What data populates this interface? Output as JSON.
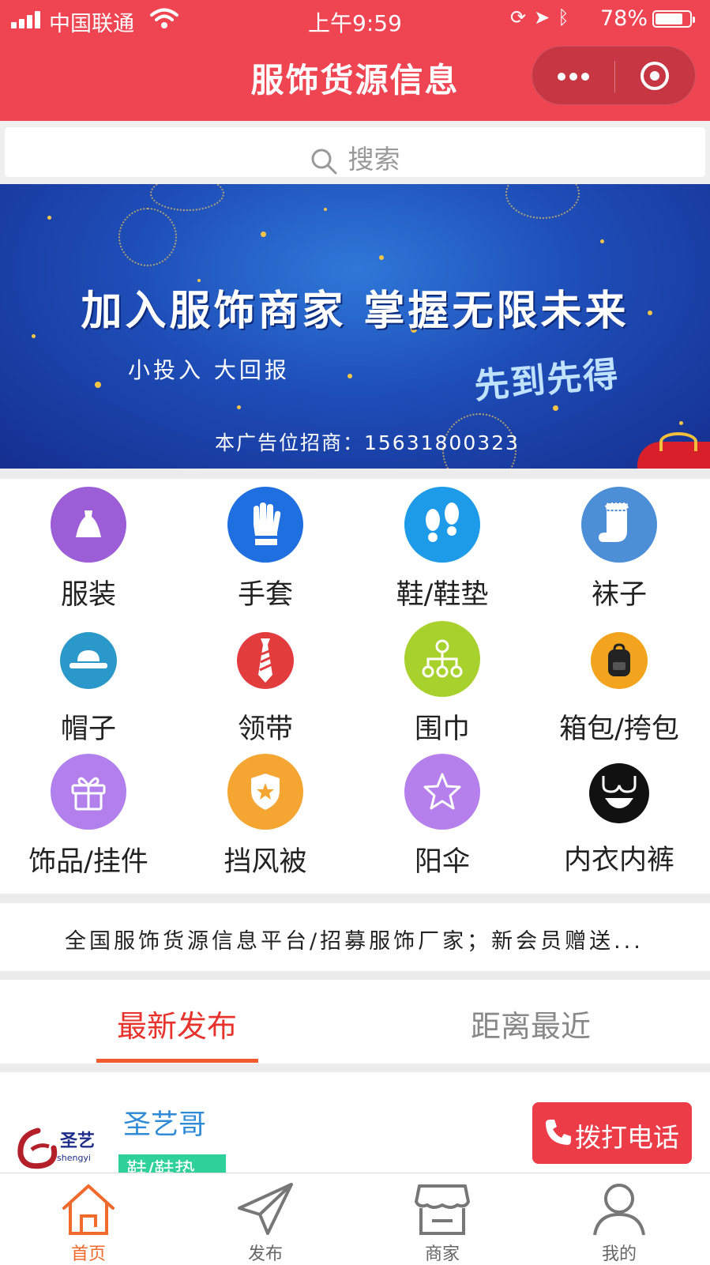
{
  "status_bar": {
    "carrier": "中国联通",
    "time": "上午9:59",
    "battery": "78%"
  },
  "nav": {
    "title": "服饰货源信息"
  },
  "search": {
    "placeholder": "搜索"
  },
  "banner": {
    "title": "加入服饰商家 掌握无限未来",
    "subtitle": "小投入 大回报",
    "slogan": "先到先得",
    "contact": "本广告位招商：15631800323",
    "slides": 2,
    "active_slide": 1
  },
  "categories": [
    {
      "label": "服装",
      "icon": "dress-icon",
      "color": "#9b5ed6"
    },
    {
      "label": "手套",
      "icon": "glove-icon",
      "color": "#1f6fe0"
    },
    {
      "label": "鞋/鞋垫",
      "icon": "footprints-icon",
      "color": "#1e9be8"
    },
    {
      "label": "袜子",
      "icon": "sock-icon",
      "color": "#4c8fd6"
    },
    {
      "label": "帽子",
      "icon": "hat-icon",
      "color": "#2a98c8"
    },
    {
      "label": "领带",
      "icon": "tie-icon",
      "color": "#e23c3c"
    },
    {
      "label": "围巾",
      "icon": "network-icon",
      "color": "#a8d12e"
    },
    {
      "label": "箱包/挎包",
      "icon": "backpack-icon",
      "color": "#f2a41f"
    },
    {
      "label": "饰品/挂件",
      "icon": "gift-icon",
      "color": "#b180ec"
    },
    {
      "label": "挡风被",
      "icon": "shield-star-icon",
      "color": "#f5a531"
    },
    {
      "label": "阳伞",
      "icon": "star-icon",
      "color": "#b680ec"
    },
    {
      "label": "内衣内裤",
      "icon": "lingerie-icon",
      "color": "#111111"
    }
  ],
  "notice": {
    "text": "全国服饰货源信息平台/招募服饰厂家；新会员赠送..."
  },
  "tabs": [
    {
      "label": "最新发布",
      "active": true
    },
    {
      "label": "距离最近",
      "active": false
    }
  ],
  "listing": {
    "logo_text": "圣艺",
    "logo_sub": "shengyi",
    "name": "圣艺哥",
    "tag": "鞋/鞋垫",
    "call_label": "拨打电话"
  },
  "bottom_nav": [
    {
      "label": "首页",
      "icon": "home-icon",
      "active": true
    },
    {
      "label": "发布",
      "icon": "paper-plane-icon",
      "active": false
    },
    {
      "label": "商家",
      "icon": "store-icon",
      "active": false
    },
    {
      "label": "我的",
      "icon": "user-icon",
      "active": false
    }
  ],
  "colors": {
    "brand_red": "#ef4552",
    "tab_active": "#e8322c",
    "bottom_active": "#ef6a2c",
    "shop_name": "#2f8bd8",
    "tag_green": "#2fd19a"
  }
}
